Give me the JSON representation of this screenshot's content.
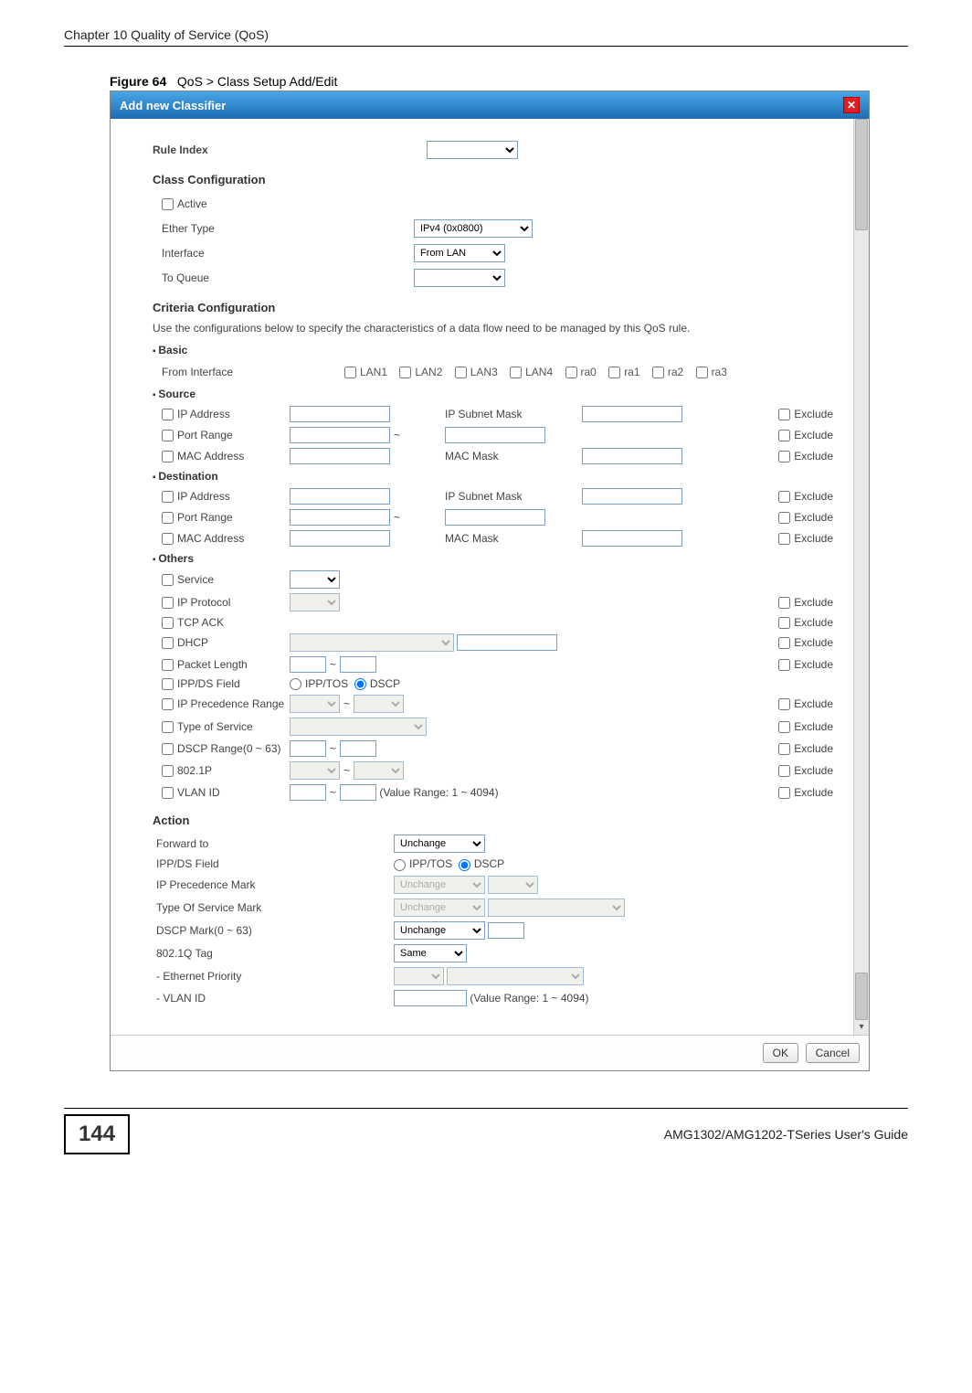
{
  "chapter_header": "Chapter 10 Quality of Service (QoS)",
  "figure_label": "Figure 64",
  "figure_caption": "QoS > Class Setup Add/Edit",
  "titlebar": "Add new Classifier",
  "close_x": "✕",
  "rule_index_label": "Rule Index",
  "class_config_title": "Class Configuration",
  "active_label": "Active",
  "ether_type_label": "Ether Type",
  "ether_type_value": "IPv4 (0x0800)",
  "interface_label": "Interface",
  "interface_value": "From LAN",
  "to_queue_label": "To Queue",
  "criteria_title": "Criteria Configuration",
  "criteria_sub": "Use the configurations below to specify the characteristics of a data flow need to be managed by this QoS rule.",
  "basic_heading": "Basic",
  "from_interface_label": "From Interface",
  "lan_checks": [
    "LAN1",
    "LAN2",
    "LAN3",
    "LAN4",
    "ra0",
    "ra1",
    "ra2",
    "ra3"
  ],
  "source_heading": "Source",
  "dest_heading": "Destination",
  "others_heading": "Others",
  "ip_address_label": "IP Address",
  "ip_subnet_label": "IP Subnet Mask",
  "port_range_label": "Port Range",
  "mac_address_label": "MAC Address",
  "mac_mask_label": "MAC Mask",
  "exclude_label": "Exclude",
  "service_label": "Service",
  "ip_protocol_label": "IP Protocol",
  "tcp_ack_label": "TCP ACK",
  "dhcp_label": "DHCP",
  "packet_length_label": "Packet Length",
  "ippds_field_label": "IPP/DS Field",
  "ipptos_radio": "IPP/TOS",
  "dscp_radio": "DSCP",
  "ip_precedence_range_label": "IP Precedence Range",
  "type_of_service_label": "Type of Service",
  "dscp_range_label": "DSCP Range(0 ~ 63)",
  "p8021_label": "802.1P",
  "vlan_id_label": "VLAN ID",
  "vlan_range_text": "(Value Range: 1 ~ 4094)",
  "action_title": "Action",
  "forward_to_label": "Forward to",
  "forward_to_value": "Unchange",
  "action_ippds_label": "IPP/DS Field",
  "ip_precedence_mark_label": "IP Precedence Mark",
  "unchange_value": "Unchange",
  "type_of_service_mark_label": "Type Of Service Mark",
  "dscp_mark_label": "DSCP Mark(0 ~ 63)",
  "tag_8021q_label": "802.1Q Tag",
  "tag_8021q_value": "Same",
  "ethernet_priority_label": "- Ethernet Priority",
  "action_vlan_id_label": "- VLAN ID",
  "ok_btn": "OK",
  "cancel_btn": "Cancel",
  "page_number": "144",
  "guide_title": "AMG1302/AMG1202-TSeries User's Guide",
  "tilde": "~"
}
